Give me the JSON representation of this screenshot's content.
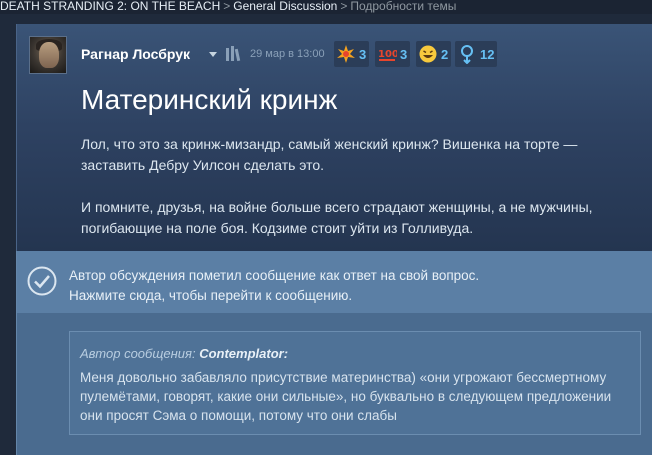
{
  "breadcrumb": {
    "game": "DEATH STRANDING 2: ON THE BEACH",
    "sep1": ">",
    "forum": "General Discussion",
    "sep2": ">",
    "current": "Подробности темы"
  },
  "post": {
    "author": "Рагнар Лосбрук",
    "date": "29 мар в 13:00",
    "awards": [
      {
        "icon": "explosion-award-icon",
        "count": "3"
      },
      {
        "icon": "hundred-award-icon",
        "count": "3"
      },
      {
        "icon": "laughing-face-award-icon",
        "count": "2"
      },
      {
        "icon": "medal-award-icon",
        "count": "12"
      }
    ],
    "title": "Материнский кринж",
    "paragraphs": [
      "Лол, что это за кринж-мизандр, самый женский кринж? Вишенка на торте — заставить Дебру Уилсон сделать это.",
      "И помните, друзья, на войне больше всего страдают женщины, а не мужчины, погибающие на поле боя. Кодзиме стоит уйти из Голливуда."
    ]
  },
  "answer": {
    "line1": "Автор обсуждения пометил сообщение как ответ на свой вопрос.",
    "line2": "Нажмите сюда, чтобы перейти к сообщению.",
    "quote_author_label": "Автор сообщения: ",
    "quote_author_name": "Contemplator:",
    "quote_text": "Меня довольно забавляло присутствие материнства) «они угрожают бессмертному пулемётами, говорят, какие они сильные», но буквально в следующем предложении они просят Сэма о помощи, потому что они слабы"
  },
  "colors": {
    "accent": "#66c0f4",
    "post_bg": "#2e4262",
    "answer_bg": "#5b7fa5"
  }
}
